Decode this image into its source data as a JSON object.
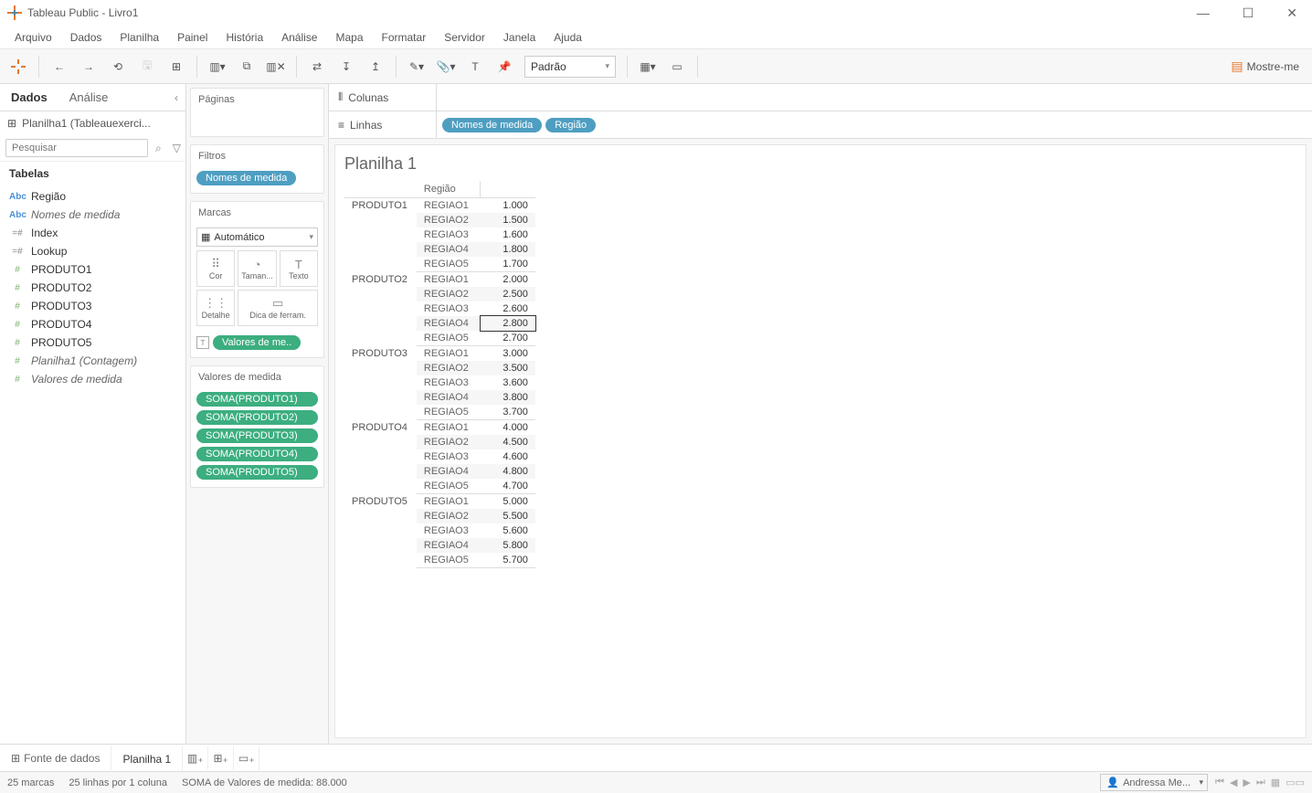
{
  "titlebar": {
    "title": "Tableau Public - Livro1"
  },
  "menubar": [
    "Arquivo",
    "Dados",
    "Planilha",
    "Painel",
    "História",
    "Análise",
    "Mapa",
    "Formatar",
    "Servidor",
    "Janela",
    "Ajuda"
  ],
  "toolbar": {
    "fit_select": "Padrão",
    "show_me": "Mostre-me"
  },
  "sidebar": {
    "tabs": {
      "data": "Dados",
      "analysis": "Análise"
    },
    "datasource": "Planilha1 (Tableauexerci...",
    "search_placeholder": "Pesquisar",
    "tables_head": "Tabelas",
    "fields": [
      {
        "icon": "Abc",
        "label": "Região",
        "cls": "abc"
      },
      {
        "icon": "Abc",
        "label": "Nomes de medida",
        "cls": "abc italic"
      },
      {
        "icon": "=#",
        "label": "Index",
        "cls": "calc"
      },
      {
        "icon": "=#",
        "label": "Lookup",
        "cls": "calc"
      },
      {
        "icon": "#",
        "label": "PRODUTO1",
        "cls": "num"
      },
      {
        "icon": "#",
        "label": "PRODUTO2",
        "cls": "num"
      },
      {
        "icon": "#",
        "label": "PRODUTO3",
        "cls": "num"
      },
      {
        "icon": "#",
        "label": "PRODUTO4",
        "cls": "num"
      },
      {
        "icon": "#",
        "label": "PRODUTO5",
        "cls": "num"
      },
      {
        "icon": "#",
        "label": "Planilha1 (Contagem)",
        "cls": "num italic"
      },
      {
        "icon": "#",
        "label": "Valores de medida",
        "cls": "num italic"
      }
    ]
  },
  "cards": {
    "pages": "Páginas",
    "filters": "Filtros",
    "filter_pill": "Nomes de medida",
    "marks": "Marcas",
    "marks_select": "Automático",
    "mark_buttons": [
      {
        "icon": "⠿",
        "label": "Cor"
      },
      {
        "icon": "◔",
        "label": "Taman..."
      },
      {
        "icon": "T",
        "label": "Texto"
      },
      {
        "icon": "⋮⋮",
        "label": "Detalhe"
      },
      {
        "icon": "▭",
        "label": "Dica de ferram."
      }
    ],
    "text_pill": "Valores de me..",
    "measures_head": "Valores de medida",
    "measure_pills": [
      "SOMA(PRODUTO1)",
      "SOMA(PRODUTO2)",
      "SOMA(PRODUTO3)",
      "SOMA(PRODUTO4)",
      "SOMA(PRODUTO5)"
    ]
  },
  "shelves": {
    "columns": "Colunas",
    "rows": "Linhas",
    "row_pills": [
      "Nomes de medida",
      "Região"
    ]
  },
  "worksheet": {
    "title": "Planilha 1",
    "header_region": "Região",
    "groups": [
      {
        "product": "PRODUTO1",
        "rows": [
          [
            "REGIAO1",
            "1.000"
          ],
          [
            "REGIAO2",
            "1.500"
          ],
          [
            "REGIAO3",
            "1.600"
          ],
          [
            "REGIAO4",
            "1.800"
          ],
          [
            "REGIAO5",
            "1.700"
          ]
        ]
      },
      {
        "product": "PRODUTO2",
        "rows": [
          [
            "REGIAO1",
            "2.000"
          ],
          [
            "REGIAO2",
            "2.500"
          ],
          [
            "REGIAO3",
            "2.600"
          ],
          [
            "REGIAO4",
            "2.800"
          ],
          [
            "REGIAO5",
            "2.700"
          ]
        ]
      },
      {
        "product": "PRODUTO3",
        "rows": [
          [
            "REGIAO1",
            "3.000"
          ],
          [
            "REGIAO2",
            "3.500"
          ],
          [
            "REGIAO3",
            "3.600"
          ],
          [
            "REGIAO4",
            "3.800"
          ],
          [
            "REGIAO5",
            "3.700"
          ]
        ]
      },
      {
        "product": "PRODUTO4",
        "rows": [
          [
            "REGIAO1",
            "4.000"
          ],
          [
            "REGIAO2",
            "4.500"
          ],
          [
            "REGIAO3",
            "4.600"
          ],
          [
            "REGIAO4",
            "4.800"
          ],
          [
            "REGIAO5",
            "4.700"
          ]
        ]
      },
      {
        "product": "PRODUTO5",
        "rows": [
          [
            "REGIAO1",
            "5.000"
          ],
          [
            "REGIAO2",
            "5.500"
          ],
          [
            "REGIAO3",
            "5.600"
          ],
          [
            "REGIAO4",
            "5.800"
          ],
          [
            "REGIAO5",
            "5.700"
          ]
        ]
      }
    ],
    "selected": "PRODUTO2:REGIAO4"
  },
  "bottom_tabs": {
    "data_source": "Fonte de dados",
    "sheet": "Planilha 1"
  },
  "statusbar": {
    "marks": "25 marcas",
    "rows_cols": "25 linhas por 1 coluna",
    "sum": "SOMA de Valores de medida: 88.000",
    "user": "Andressa Me..."
  }
}
